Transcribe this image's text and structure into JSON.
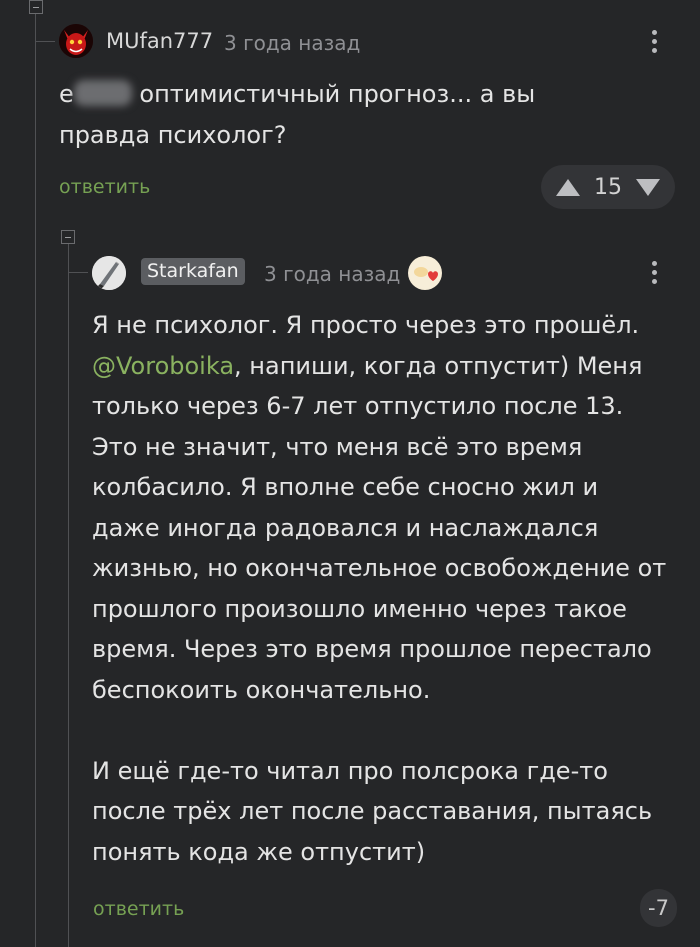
{
  "comments": [
    {
      "username": "MUfan777",
      "time": "3 года назад",
      "text_before_blur": "е",
      "text_after_blur": "оптимистичный прогноз... а вы",
      "text_line2": "правда психолог?",
      "reply_label": "ответить",
      "rating": "15"
    },
    {
      "username": "Starkafan",
      "time": "3 года назад",
      "paragraph1_start": "Я не психолог. Я просто через это прошёл.",
      "mention": "@Voroboika",
      "paragraph1_rest": ", напиши, когда отпустит) Меня только через 6-7 лет отпустило после 13. Это не значит, что меня всё это время колбасило. Я вполне себе сносно жил и даже иногда радовался и наслаждался жизнью, но окончательное освобождение от прошлого произошло именно через такое время. Через это время прошлое перестало беспокоить окончательно.",
      "paragraph2": "И ещё где-то читал про полсрока где-то после трёх лет после расставания, пытаясь понять кода же отпустит)",
      "reply_label": "ответить",
      "rating": "-7"
    }
  ],
  "icons": {
    "collapse": "collapse-icon",
    "menu": "more-vertical-icon",
    "upvote": "upvote-triangle-icon",
    "downvote": "downvote-triangle-icon",
    "award": "award-heart-icon"
  },
  "colors": {
    "background": "#252628",
    "link_green": "#76a153",
    "mention_green": "#8ab260",
    "badge_gray": "#5b5d61"
  }
}
